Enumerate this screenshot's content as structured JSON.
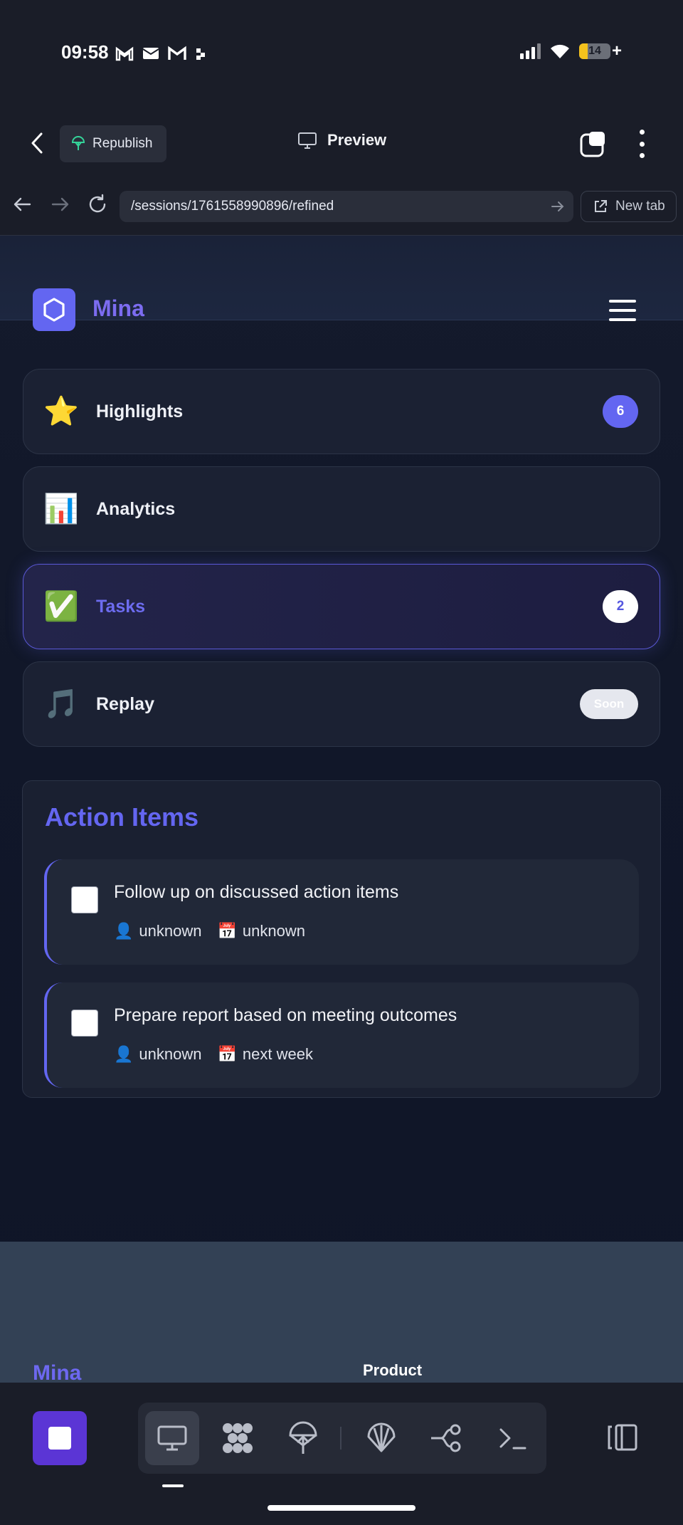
{
  "status_bar": {
    "time": "09:58",
    "left_icons": [
      "gmail-icon",
      "mail-icon",
      "gmail-alt-icon",
      "app-dots-icon"
    ],
    "battery_level": "14"
  },
  "app_header": {
    "republish_label": "Republish",
    "preview_label": "Preview"
  },
  "browser": {
    "url": "/sessions/1761558990896/refined",
    "new_tab_label": "New tab"
  },
  "site": {
    "brand": "Mina",
    "accent_color": "#6366f1"
  },
  "menu": [
    {
      "emoji": "⭐",
      "label": "Highlights",
      "badge": "6",
      "active": false
    },
    {
      "emoji": "📊",
      "label": "Analytics",
      "badge": "",
      "active": false
    },
    {
      "emoji": "✅",
      "label": "Tasks",
      "badge": "2",
      "active": true
    },
    {
      "emoji": "🎵",
      "label": "Replay",
      "tag": "Soon",
      "active": false
    }
  ],
  "action_items": {
    "title": "Action Items",
    "items": [
      {
        "title": "Follow up on discussed action items",
        "assignee": "unknown",
        "due": "unknown",
        "checked": false
      },
      {
        "title": "Prepare report based on meeting outcomes",
        "assignee": "unknown",
        "due": "next week",
        "checked": false
      }
    ]
  },
  "footer": {
    "brand": "Mina",
    "product_heading": "Product"
  },
  "toolbar": {
    "tools": [
      "monitor-icon",
      "grid-icon",
      "parachute-icon",
      "shell-icon",
      "flow-icon",
      "terminal-icon"
    ],
    "selected": "monitor-icon"
  }
}
